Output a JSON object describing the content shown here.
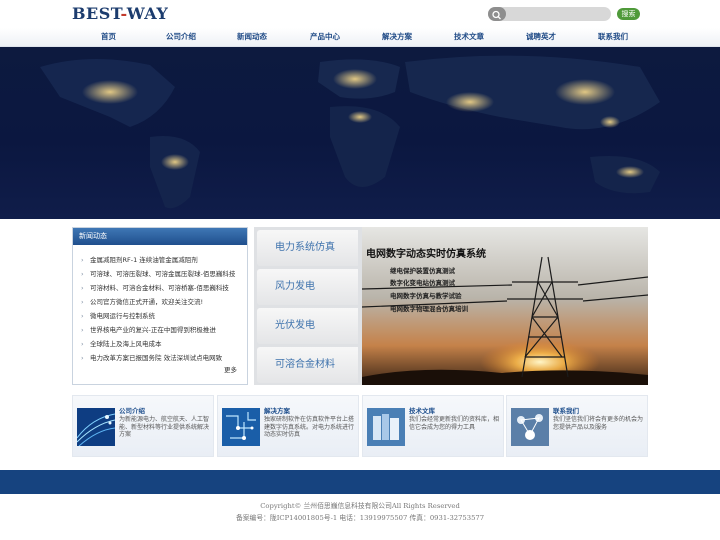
{
  "header": {
    "logo_part1": "BEST",
    "logo_dash": "-",
    "logo_part2": "WAY",
    "search_placeholder": "",
    "search_button": "搜索"
  },
  "nav": {
    "items": [
      "首页",
      "公司介绍",
      "新闻动态",
      "产品中心",
      "解决方案",
      "技术文章",
      "诚聘英才",
      "联系我们"
    ]
  },
  "news": {
    "title": "新闻动态",
    "items": [
      "金属减阻剂RF-1 连续油管金属减阻剂",
      "可溶球、可溶压裂球、可溶金属压裂球-佰思巍科技",
      "可溶材料、可溶合金材料、可溶桥塞-佰思巍科技",
      "公司官方微信正式开通，欢迎关注交流!",
      "微电网运行与控制系统",
      "世界核电产业的复兴-正在中国得到积极推进",
      "全球陆上及海上风电成本",
      "电力改革方案已报国务院 效法深圳试点电网致"
    ],
    "more": "更多"
  },
  "tabs": [
    "电力系统仿真",
    "风力发电",
    "光伏发电",
    "可溶合金材料"
  ],
  "feature": {
    "title": "电网数字动态实时仿真系统",
    "lines": [
      "继电保护装置仿真测试",
      "数字化变电站仿真测试",
      "电网数字仿真与教学试验",
      "电网数字物理混合仿真培训"
    ]
  },
  "cards": [
    {
      "title": "公司介绍",
      "desc": "为新能源电力、航空航天、人工智能、新型材料等行业提供系统解决方案"
    },
    {
      "title": "解决方案",
      "desc": "独家研制软件在仿真软件平台上搭建数字仿真系统。对电力系统进行动态实时仿真"
    },
    {
      "title": "技术文库",
      "desc": "我们会经常更新我们的资料库，相信它会成为您的得力工具"
    },
    {
      "title": "联系我们",
      "desc": "我们坚信我们将会有更多的机会为您提供产品以及服务"
    }
  ],
  "footer": {
    "copyright": "Copyright© 兰州佰思巍信息科技有限公司All Rights Reserved",
    "icp": "备案编号：陇ICP14001805号-1 电话：13919975507 传真：0931-32753577"
  },
  "colors": {
    "brand_blue": "#1c3c6e",
    "nav_text": "#1f4a86",
    "accent_red": "#c23a2b",
    "search_green": "#4f9a3a",
    "footer_bar": "#16437f"
  }
}
